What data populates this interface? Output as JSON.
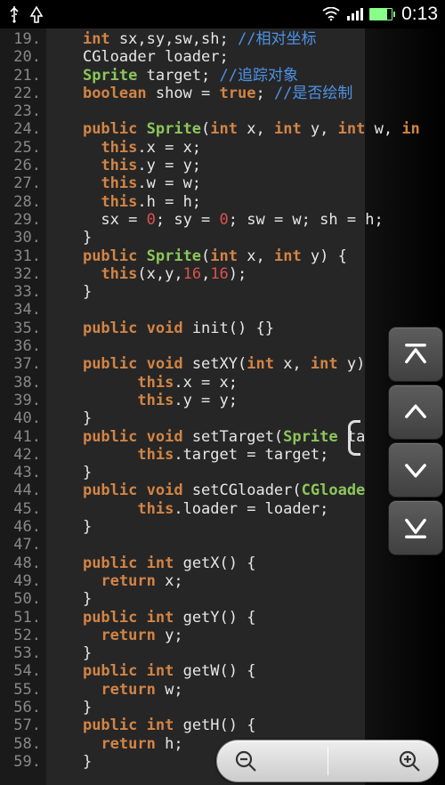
{
  "status_bar": {
    "time": "0:13",
    "icons": {
      "usb": "usb",
      "arrow": "upload",
      "wifi": "wifi",
      "signal": "signal",
      "battery": "battery"
    }
  },
  "editor": {
    "first_line_number": 19,
    "last_line_number": 59,
    "lines": [
      {
        "n": "19.",
        "tokens": [
          [
            "kw",
            "int"
          ],
          [
            "txt",
            " sx,sy,sw,sh; "
          ],
          [
            "cmt",
            "//相对坐标"
          ]
        ]
      },
      {
        "n": "20.",
        "tokens": [
          [
            "txt",
            "CGloader loader;"
          ]
        ]
      },
      {
        "n": "21.",
        "tokens": [
          [
            "type",
            "Sprite"
          ],
          [
            "txt",
            " target; "
          ],
          [
            "cmt",
            "//追踪对象"
          ]
        ]
      },
      {
        "n": "22.",
        "tokens": [
          [
            "kw",
            "boolean"
          ],
          [
            "txt",
            " show = "
          ],
          [
            "kw",
            "true"
          ],
          [
            "txt",
            "; "
          ],
          [
            "cmt",
            "//是否绘制"
          ]
        ]
      },
      {
        "n": "23.",
        "tokens": []
      },
      {
        "n": "24.",
        "tokens": [
          [
            "kw",
            "public"
          ],
          [
            "txt",
            " "
          ],
          [
            "type",
            "Sprite"
          ],
          [
            "txt",
            "("
          ],
          [
            "kw",
            "int"
          ],
          [
            "txt",
            " x, "
          ],
          [
            "kw",
            "int"
          ],
          [
            "txt",
            " y, "
          ],
          [
            "kw",
            "int"
          ],
          [
            "txt",
            " w, "
          ],
          [
            "kw",
            "in"
          ]
        ]
      },
      {
        "n": "25.",
        "tokens": [
          [
            "txt",
            "  "
          ],
          [
            "kw",
            "this"
          ],
          [
            "txt",
            ".x = x;"
          ]
        ]
      },
      {
        "n": "26.",
        "tokens": [
          [
            "txt",
            "  "
          ],
          [
            "kw",
            "this"
          ],
          [
            "txt",
            ".y = y;"
          ]
        ]
      },
      {
        "n": "27.",
        "tokens": [
          [
            "txt",
            "  "
          ],
          [
            "kw",
            "this"
          ],
          [
            "txt",
            ".w = w;"
          ]
        ]
      },
      {
        "n": "28.",
        "tokens": [
          [
            "txt",
            "  "
          ],
          [
            "kw",
            "this"
          ],
          [
            "txt",
            ".h = h;"
          ]
        ]
      },
      {
        "n": "29.",
        "tokens": [
          [
            "txt",
            "  sx = "
          ],
          [
            "num",
            "0"
          ],
          [
            "txt",
            "; sy = "
          ],
          [
            "num",
            "0"
          ],
          [
            "txt",
            "; sw = w; sh = h;"
          ]
        ]
      },
      {
        "n": "30.",
        "tokens": [
          [
            "txt",
            "}"
          ]
        ]
      },
      {
        "n": "31.",
        "tokens": [
          [
            "kw",
            "public"
          ],
          [
            "txt",
            " "
          ],
          [
            "type",
            "Sprite"
          ],
          [
            "txt",
            "("
          ],
          [
            "kw",
            "int"
          ],
          [
            "txt",
            " x, "
          ],
          [
            "kw",
            "int"
          ],
          [
            "txt",
            " y) {"
          ]
        ]
      },
      {
        "n": "32.",
        "tokens": [
          [
            "txt",
            "  "
          ],
          [
            "kw",
            "this"
          ],
          [
            "txt",
            "(x,y,"
          ],
          [
            "num",
            "16"
          ],
          [
            "txt",
            ","
          ],
          [
            "num",
            "16"
          ],
          [
            "txt",
            ");"
          ]
        ]
      },
      {
        "n": "33.",
        "tokens": [
          [
            "txt",
            "}"
          ]
        ]
      },
      {
        "n": "34.",
        "tokens": []
      },
      {
        "n": "35.",
        "tokens": [
          [
            "kw",
            "public"
          ],
          [
            "txt",
            " "
          ],
          [
            "kw",
            "void"
          ],
          [
            "txt",
            " init() {}"
          ]
        ]
      },
      {
        "n": "36.",
        "tokens": []
      },
      {
        "n": "37.",
        "tokens": [
          [
            "kw",
            "public"
          ],
          [
            "txt",
            " "
          ],
          [
            "kw",
            "void"
          ],
          [
            "txt",
            " setXY("
          ],
          [
            "kw",
            "int"
          ],
          [
            "txt",
            " x, "
          ],
          [
            "kw",
            "int"
          ],
          [
            "txt",
            " y)"
          ]
        ]
      },
      {
        "n": "38.",
        "tokens": [
          [
            "txt",
            "      "
          ],
          [
            "kw",
            "this"
          ],
          [
            "txt",
            ".x = x;"
          ]
        ]
      },
      {
        "n": "39.",
        "tokens": [
          [
            "txt",
            "      "
          ],
          [
            "kw",
            "this"
          ],
          [
            "txt",
            ".y = y;"
          ]
        ]
      },
      {
        "n": "40.",
        "tokens": [
          [
            "txt",
            "}"
          ]
        ]
      },
      {
        "n": "41.",
        "tokens": [
          [
            "kw",
            "public"
          ],
          [
            "txt",
            " "
          ],
          [
            "kw",
            "void"
          ],
          [
            "txt",
            " setTarget("
          ],
          [
            "type",
            "Sprite"
          ],
          [
            "txt",
            " ta"
          ]
        ]
      },
      {
        "n": "42.",
        "tokens": [
          [
            "txt",
            "      "
          ],
          [
            "kw",
            "this"
          ],
          [
            "txt",
            ".target = target;"
          ]
        ]
      },
      {
        "n": "43.",
        "tokens": [
          [
            "txt",
            "}"
          ]
        ]
      },
      {
        "n": "44.",
        "tokens": [
          [
            "kw",
            "public"
          ],
          [
            "txt",
            " "
          ],
          [
            "kw",
            "void"
          ],
          [
            "txt",
            " setCGloader("
          ],
          [
            "type",
            "CGloade"
          ]
        ]
      },
      {
        "n": "45.",
        "tokens": [
          [
            "txt",
            "      "
          ],
          [
            "kw",
            "this"
          ],
          [
            "txt",
            ".loader = loader;"
          ]
        ]
      },
      {
        "n": "46.",
        "tokens": [
          [
            "txt",
            "}"
          ]
        ]
      },
      {
        "n": "47.",
        "tokens": []
      },
      {
        "n": "48.",
        "tokens": [
          [
            "kw",
            "public"
          ],
          [
            "txt",
            " "
          ],
          [
            "kw",
            "int"
          ],
          [
            "txt",
            " getX() {"
          ]
        ]
      },
      {
        "n": "49.",
        "tokens": [
          [
            "txt",
            "  "
          ],
          [
            "kw",
            "return"
          ],
          [
            "txt",
            " x;"
          ]
        ]
      },
      {
        "n": "50.",
        "tokens": [
          [
            "txt",
            "}"
          ]
        ]
      },
      {
        "n": "51.",
        "tokens": [
          [
            "kw",
            "public"
          ],
          [
            "txt",
            " "
          ],
          [
            "kw",
            "int"
          ],
          [
            "txt",
            " getY() {"
          ]
        ]
      },
      {
        "n": "52.",
        "tokens": [
          [
            "txt",
            "  "
          ],
          [
            "kw",
            "return"
          ],
          [
            "txt",
            " y;"
          ]
        ]
      },
      {
        "n": "53.",
        "tokens": [
          [
            "txt",
            "}"
          ]
        ]
      },
      {
        "n": "54.",
        "tokens": [
          [
            "kw",
            "public"
          ],
          [
            "txt",
            " "
          ],
          [
            "kw",
            "int"
          ],
          [
            "txt",
            " getW() {"
          ]
        ]
      },
      {
        "n": "55.",
        "tokens": [
          [
            "txt",
            "  "
          ],
          [
            "kw",
            "return"
          ],
          [
            "txt",
            " w;"
          ]
        ]
      },
      {
        "n": "56.",
        "tokens": [
          [
            "txt",
            "}"
          ]
        ]
      },
      {
        "n": "57.",
        "tokens": [
          [
            "kw",
            "public"
          ],
          [
            "txt",
            " "
          ],
          [
            "kw",
            "int"
          ],
          [
            "txt",
            " getH() {"
          ]
        ]
      },
      {
        "n": "58.",
        "tokens": [
          [
            "txt",
            "  "
          ],
          [
            "kw",
            "return"
          ],
          [
            "txt",
            " h;"
          ]
        ]
      },
      {
        "n": "59.",
        "tokens": [
          [
            "txt",
            "}"
          ]
        ]
      }
    ]
  },
  "nav": {
    "top": "scroll-top",
    "up": "scroll-up",
    "down": "scroll-down",
    "bottom": "scroll-bottom"
  },
  "zoom": {
    "out": "zoom-out",
    "in": "zoom-in"
  }
}
